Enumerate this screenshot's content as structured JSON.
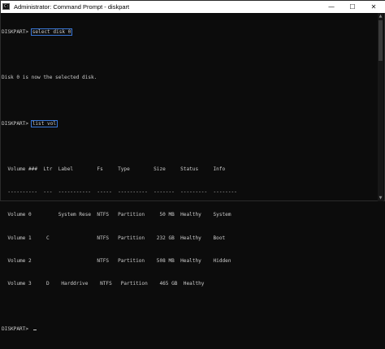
{
  "window": {
    "title": "Administrator: Command Prompt - diskpart",
    "icon_text": "C:\\",
    "minimize_glyph": "—",
    "maximize_glyph": "☐",
    "close_glyph": "✕"
  },
  "console": {
    "cmd1_prompt": "DISKPART> ",
    "cmd1_text": "select disk 0",
    "cmd1_output": "Disk 0 is now the selected disk.",
    "cmd2_prompt": "DISKPART> ",
    "cmd2_text": "list vol",
    "table_header": "  Volume ###  Ltr  Label        Fs     Type        Size     Status     Info",
    "table_separator": "  ----------  ---  -----------  -----  ----------  -------  ---------  --------",
    "rows": [
      "  Volume 0         System Rese  NTFS   Partition     50 MB  Healthy    System",
      "  Volume 1     C                NTFS   Partition    232 GB  Healthy    Boot",
      "  Volume 2                      NTFS   Partition    508 MB  Healthy    Hidden",
      "  Volume 3     D    Harddrive    NTFS   Partition    465 GB  Healthy"
    ],
    "final_prompt": "DISKPART> "
  },
  "colors": {
    "background": "#0c0c0c",
    "text": "#cccccc",
    "highlight_border": "#3b78d8"
  }
}
